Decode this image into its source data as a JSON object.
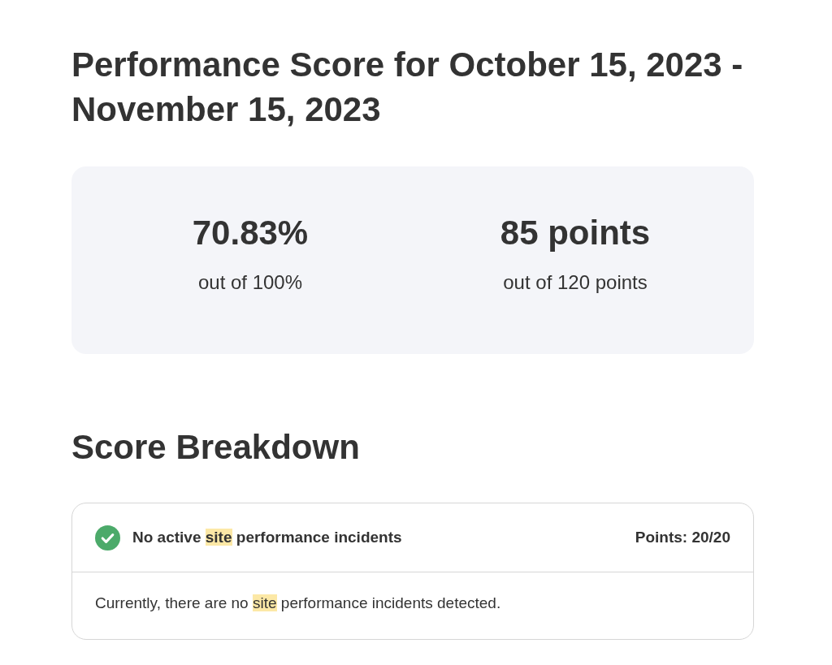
{
  "heading": "Performance Score for October 15, 2023 - November 15, 2023",
  "summary": [
    {
      "value": "70.83%",
      "caption": "out of 100%"
    },
    {
      "value": "85 points",
      "caption": "out of 120 points"
    }
  ],
  "section_title": "Score Breakdown",
  "breakdown": [
    {
      "passed": true,
      "title": [
        {
          "text": "No active ",
          "highlighted": false
        },
        {
          "text": "site",
          "highlighted": true
        },
        {
          "text": " performance incidents",
          "highlighted": false
        }
      ],
      "points": "Points: 20/20",
      "detail": [
        {
          "text": "Currently, there are no ",
          "highlighted": false
        },
        {
          "text": "site",
          "highlighted": true
        },
        {
          "text": " performance incidents detected.",
          "highlighted": false
        }
      ]
    }
  ]
}
